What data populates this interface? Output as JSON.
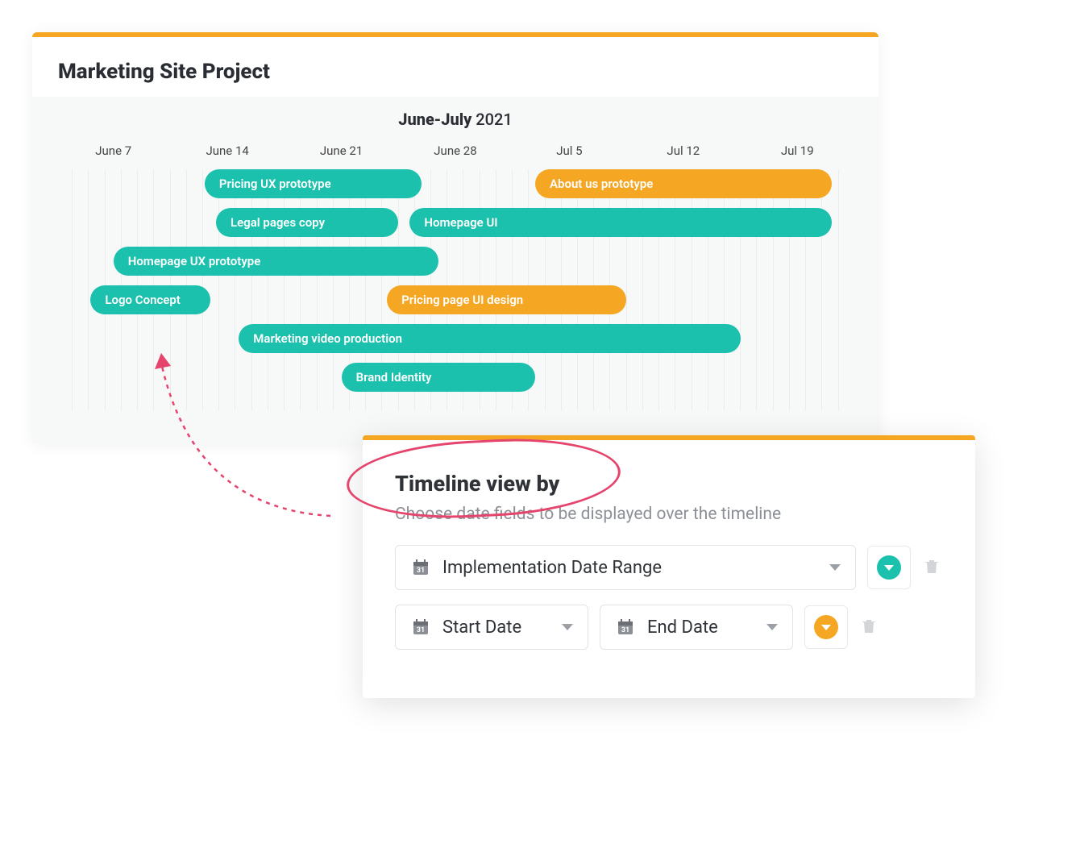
{
  "gantt": {
    "title": "Marketing Site Project",
    "period_range": "June-July",
    "period_year": "2021",
    "columns": [
      "June 7",
      "June 14",
      "June 21",
      "June 28",
      "Jul 5",
      "Jul 12",
      "Jul 19"
    ],
    "tasks": [
      {
        "label": "Pricing UX prototype",
        "color": "teal",
        "row": 0,
        "start": 1.3,
        "span": 1.9
      },
      {
        "label": "About us prototype",
        "color": "orange",
        "row": 0,
        "start": 4.2,
        "span": 2.6
      },
      {
        "label": "Legal pages copy",
        "color": "teal",
        "row": 1,
        "start": 1.4,
        "span": 1.6
      },
      {
        "label": "Homepage UI",
        "color": "teal",
        "row": 1,
        "start": 3.1,
        "span": 3.7
      },
      {
        "label": "Homepage UX prototype",
        "color": "teal",
        "row": 2,
        "start": 0.5,
        "span": 2.85
      },
      {
        "label": "Logo Concept",
        "color": "teal",
        "row": 3,
        "start": 0.3,
        "span": 1.05
      },
      {
        "label": "Pricing page UI design",
        "color": "orange",
        "row": 3,
        "start": 2.9,
        "span": 2.1
      },
      {
        "label": "Marketing video production",
        "color": "teal",
        "row": 4,
        "start": 1.6,
        "span": 4.4
      },
      {
        "label": "Brand Identity",
        "color": "teal",
        "row": 5,
        "start": 2.5,
        "span": 1.7
      }
    ]
  },
  "popover": {
    "title": "Timeline view by",
    "subtitle": "Choose date fields to be displayed over the timeline",
    "rows": [
      {
        "type": "range",
        "field": "Implementation Date Range",
        "color": "teal"
      },
      {
        "type": "pair",
        "start": "Start Date",
        "end": "End Date",
        "color": "orange"
      }
    ]
  },
  "colors": {
    "teal": "#1bc1ac",
    "orange": "#f5a623",
    "accent_red": "#e5446d"
  }
}
